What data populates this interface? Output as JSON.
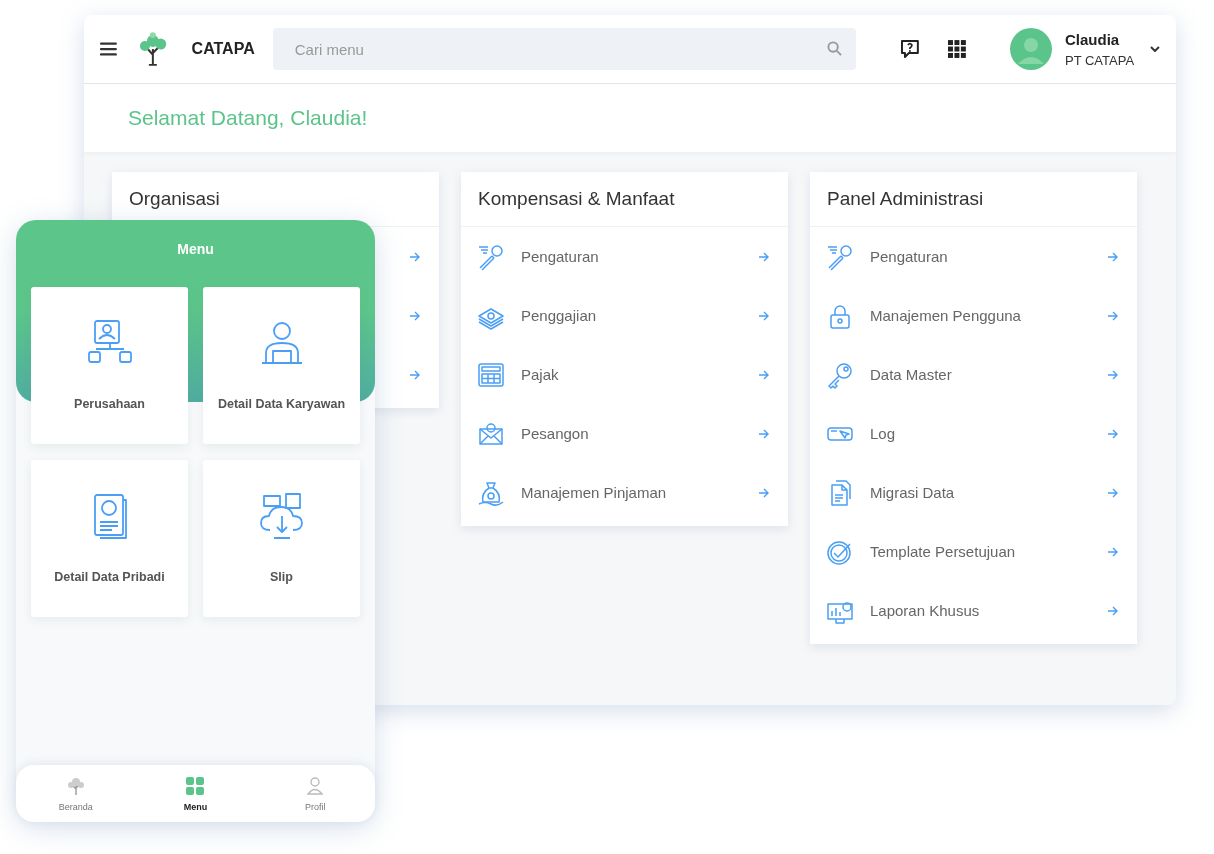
{
  "topbar": {
    "brand": "CATAPA",
    "search": {
      "placeholder": "Cari menu"
    },
    "user": {
      "name": "Claudia",
      "company": "PT CATAPA"
    }
  },
  "welcome": "Selamat Datang, Claudia!",
  "cards": [
    {
      "title": "Organisasi",
      "items": [
        {
          "kind": "link"
        },
        {
          "kind": "link"
        },
        {
          "kind": "link"
        }
      ]
    },
    {
      "title": "Kompensasi & Manfaat",
      "items": [
        {
          "kind": "link",
          "label": "Pengaturan"
        },
        {
          "kind": "link",
          "label": "Penggajian"
        },
        {
          "kind": "link",
          "label": "Pajak"
        },
        {
          "kind": "link",
          "label": "Pesangon"
        },
        {
          "kind": "link",
          "label": "Manajemen Pinjaman"
        }
      ]
    },
    {
      "title": "Panel Administrasi",
      "items": [
        {
          "kind": "link",
          "label": "Pengaturan"
        },
        {
          "kind": "link",
          "label": "Manajemen Pengguna"
        },
        {
          "kind": "link",
          "label": "Data Master"
        },
        {
          "kind": "link",
          "label": "Log"
        },
        {
          "kind": "link",
          "label": "Migrasi Data"
        },
        {
          "kind": "link",
          "label": "Template Persetujuan"
        },
        {
          "kind": "link",
          "label": "Laporan Khusus"
        }
      ]
    }
  ],
  "phone": {
    "title": "Menu",
    "tiles": [
      {
        "label": "Perusahaan"
      },
      {
        "label": "Detail Data Karyawan"
      },
      {
        "label": "Detail Data Pribadi"
      },
      {
        "label": "Slip"
      }
    ],
    "nav": [
      {
        "label": "Beranda",
        "selected": false
      },
      {
        "label": "Menu",
        "selected": true
      },
      {
        "label": "Profil",
        "selected": false
      }
    ]
  }
}
